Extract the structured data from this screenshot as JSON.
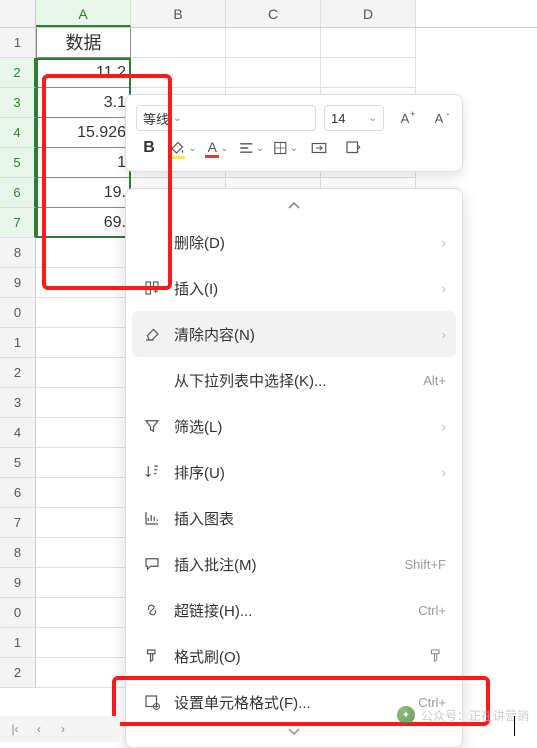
{
  "columns": [
    "A",
    "B",
    "C",
    "D"
  ],
  "rowNumbers": [
    "1",
    "2",
    "3",
    "4",
    "5",
    "6",
    "7",
    "8",
    "9",
    "0",
    "1",
    "2",
    "3",
    "4",
    "5",
    "6",
    "7",
    "8",
    "9",
    "0",
    "1",
    "2"
  ],
  "cells": {
    "header": "数据",
    "values": [
      "11.2",
      "3.1",
      "15.926",
      "1",
      "19.",
      "69."
    ]
  },
  "miniToolbar": {
    "font": "等线",
    "size": "14"
  },
  "menu": {
    "delete": "删除(D)",
    "insert": "插入(I)",
    "clear": "清除内容(N)",
    "dropdown": "从下拉列表中选择(K)...",
    "dropdown_shortcut": "Alt+",
    "filter": "筛选(L)",
    "sort": "排序(U)",
    "chart": "插入图表",
    "comment": "插入批注(M)",
    "comment_shortcut": "Shift+F",
    "hyperlink": "超链接(H)...",
    "hyperlink_shortcut": "Ctrl+",
    "formatpaint": "格式刷(O)",
    "cellformat": "设置单元格格式(F)...",
    "cellformat_shortcut": "Ctrl+"
  },
  "watermark": "公众号：正在讲营销"
}
